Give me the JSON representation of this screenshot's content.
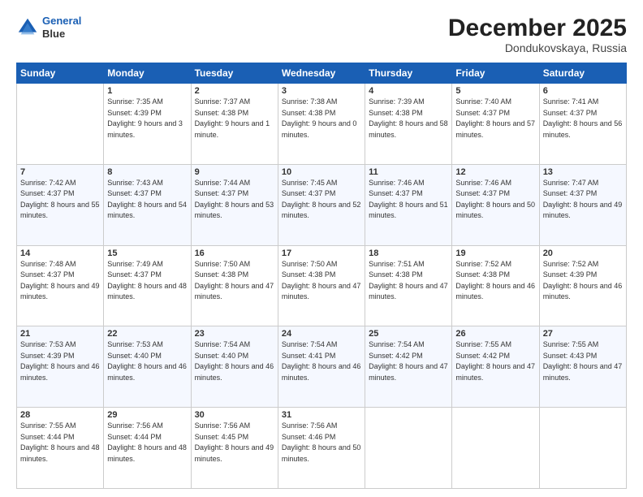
{
  "header": {
    "logo_line1": "General",
    "logo_line2": "Blue",
    "title": "December 2025",
    "subtitle": "Dondukovskaya, Russia"
  },
  "days_of_week": [
    "Sunday",
    "Monday",
    "Tuesday",
    "Wednesday",
    "Thursday",
    "Friday",
    "Saturday"
  ],
  "weeks": [
    [
      {
        "day": "",
        "sunrise": "",
        "sunset": "",
        "daylight": ""
      },
      {
        "day": "1",
        "sunrise": "Sunrise: 7:35 AM",
        "sunset": "Sunset: 4:39 PM",
        "daylight": "Daylight: 9 hours and 3 minutes."
      },
      {
        "day": "2",
        "sunrise": "Sunrise: 7:37 AM",
        "sunset": "Sunset: 4:38 PM",
        "daylight": "Daylight: 9 hours and 1 minute."
      },
      {
        "day": "3",
        "sunrise": "Sunrise: 7:38 AM",
        "sunset": "Sunset: 4:38 PM",
        "daylight": "Daylight: 9 hours and 0 minutes."
      },
      {
        "day": "4",
        "sunrise": "Sunrise: 7:39 AM",
        "sunset": "Sunset: 4:38 PM",
        "daylight": "Daylight: 8 hours and 58 minutes."
      },
      {
        "day": "5",
        "sunrise": "Sunrise: 7:40 AM",
        "sunset": "Sunset: 4:37 PM",
        "daylight": "Daylight: 8 hours and 57 minutes."
      },
      {
        "day": "6",
        "sunrise": "Sunrise: 7:41 AM",
        "sunset": "Sunset: 4:37 PM",
        "daylight": "Daylight: 8 hours and 56 minutes."
      }
    ],
    [
      {
        "day": "7",
        "sunrise": "Sunrise: 7:42 AM",
        "sunset": "Sunset: 4:37 PM",
        "daylight": "Daylight: 8 hours and 55 minutes."
      },
      {
        "day": "8",
        "sunrise": "Sunrise: 7:43 AM",
        "sunset": "Sunset: 4:37 PM",
        "daylight": "Daylight: 8 hours and 54 minutes."
      },
      {
        "day": "9",
        "sunrise": "Sunrise: 7:44 AM",
        "sunset": "Sunset: 4:37 PM",
        "daylight": "Daylight: 8 hours and 53 minutes."
      },
      {
        "day": "10",
        "sunrise": "Sunrise: 7:45 AM",
        "sunset": "Sunset: 4:37 PM",
        "daylight": "Daylight: 8 hours and 52 minutes."
      },
      {
        "day": "11",
        "sunrise": "Sunrise: 7:46 AM",
        "sunset": "Sunset: 4:37 PM",
        "daylight": "Daylight: 8 hours and 51 minutes."
      },
      {
        "day": "12",
        "sunrise": "Sunrise: 7:46 AM",
        "sunset": "Sunset: 4:37 PM",
        "daylight": "Daylight: 8 hours and 50 minutes."
      },
      {
        "day": "13",
        "sunrise": "Sunrise: 7:47 AM",
        "sunset": "Sunset: 4:37 PM",
        "daylight": "Daylight: 8 hours and 49 minutes."
      }
    ],
    [
      {
        "day": "14",
        "sunrise": "Sunrise: 7:48 AM",
        "sunset": "Sunset: 4:37 PM",
        "daylight": "Daylight: 8 hours and 49 minutes."
      },
      {
        "day": "15",
        "sunrise": "Sunrise: 7:49 AM",
        "sunset": "Sunset: 4:37 PM",
        "daylight": "Daylight: 8 hours and 48 minutes."
      },
      {
        "day": "16",
        "sunrise": "Sunrise: 7:50 AM",
        "sunset": "Sunset: 4:38 PM",
        "daylight": "Daylight: 8 hours and 47 minutes."
      },
      {
        "day": "17",
        "sunrise": "Sunrise: 7:50 AM",
        "sunset": "Sunset: 4:38 PM",
        "daylight": "Daylight: 8 hours and 47 minutes."
      },
      {
        "day": "18",
        "sunrise": "Sunrise: 7:51 AM",
        "sunset": "Sunset: 4:38 PM",
        "daylight": "Daylight: 8 hours and 47 minutes."
      },
      {
        "day": "19",
        "sunrise": "Sunrise: 7:52 AM",
        "sunset": "Sunset: 4:38 PM",
        "daylight": "Daylight: 8 hours and 46 minutes."
      },
      {
        "day": "20",
        "sunrise": "Sunrise: 7:52 AM",
        "sunset": "Sunset: 4:39 PM",
        "daylight": "Daylight: 8 hours and 46 minutes."
      }
    ],
    [
      {
        "day": "21",
        "sunrise": "Sunrise: 7:53 AM",
        "sunset": "Sunset: 4:39 PM",
        "daylight": "Daylight: 8 hours and 46 minutes."
      },
      {
        "day": "22",
        "sunrise": "Sunrise: 7:53 AM",
        "sunset": "Sunset: 4:40 PM",
        "daylight": "Daylight: 8 hours and 46 minutes."
      },
      {
        "day": "23",
        "sunrise": "Sunrise: 7:54 AM",
        "sunset": "Sunset: 4:40 PM",
        "daylight": "Daylight: 8 hours and 46 minutes."
      },
      {
        "day": "24",
        "sunrise": "Sunrise: 7:54 AM",
        "sunset": "Sunset: 4:41 PM",
        "daylight": "Daylight: 8 hours and 46 minutes."
      },
      {
        "day": "25",
        "sunrise": "Sunrise: 7:54 AM",
        "sunset": "Sunset: 4:42 PM",
        "daylight": "Daylight: 8 hours and 47 minutes."
      },
      {
        "day": "26",
        "sunrise": "Sunrise: 7:55 AM",
        "sunset": "Sunset: 4:42 PM",
        "daylight": "Daylight: 8 hours and 47 minutes."
      },
      {
        "day": "27",
        "sunrise": "Sunrise: 7:55 AM",
        "sunset": "Sunset: 4:43 PM",
        "daylight": "Daylight: 8 hours and 47 minutes."
      }
    ],
    [
      {
        "day": "28",
        "sunrise": "Sunrise: 7:55 AM",
        "sunset": "Sunset: 4:44 PM",
        "daylight": "Daylight: 8 hours and 48 minutes."
      },
      {
        "day": "29",
        "sunrise": "Sunrise: 7:56 AM",
        "sunset": "Sunset: 4:44 PM",
        "daylight": "Daylight: 8 hours and 48 minutes."
      },
      {
        "day": "30",
        "sunrise": "Sunrise: 7:56 AM",
        "sunset": "Sunset: 4:45 PM",
        "daylight": "Daylight: 8 hours and 49 minutes."
      },
      {
        "day": "31",
        "sunrise": "Sunrise: 7:56 AM",
        "sunset": "Sunset: 4:46 PM",
        "daylight": "Daylight: 8 hours and 50 minutes."
      },
      {
        "day": "",
        "sunrise": "",
        "sunset": "",
        "daylight": ""
      },
      {
        "day": "",
        "sunrise": "",
        "sunset": "",
        "daylight": ""
      },
      {
        "day": "",
        "sunrise": "",
        "sunset": "",
        "daylight": ""
      }
    ]
  ]
}
